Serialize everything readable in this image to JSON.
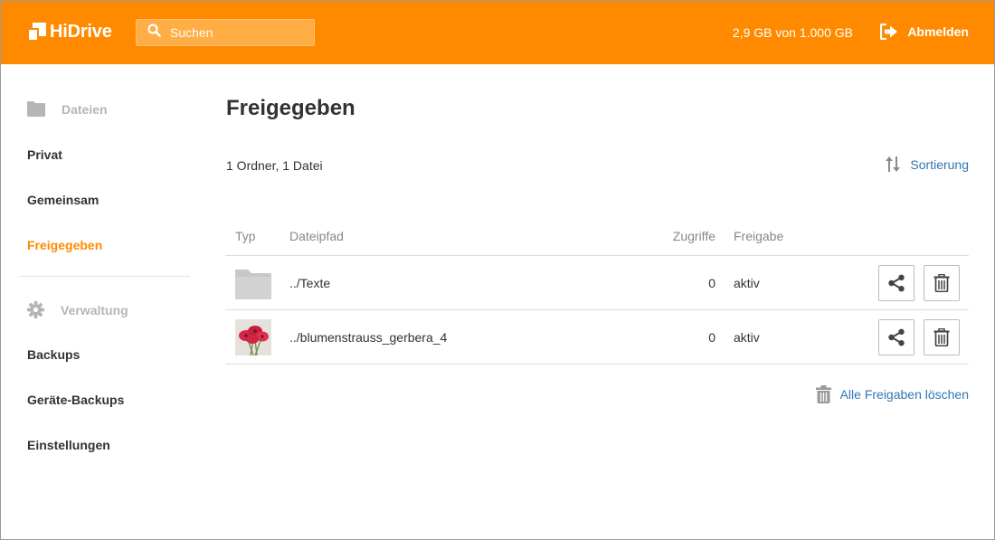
{
  "header": {
    "logo_text": "HiDrive",
    "search_placeholder": "Suchen",
    "quota": "2,9 GB von 1.000 GB",
    "logout_label": "Abmelden",
    "accent_color": "#ff8a00"
  },
  "sidebar": {
    "section_files": "Dateien",
    "items_files": [
      {
        "label": "Privat",
        "active": false
      },
      {
        "label": "Gemeinsam",
        "active": false
      },
      {
        "label": "Freigegeben",
        "active": true
      }
    ],
    "section_admin": "Verwaltung",
    "items_admin": [
      {
        "label": "Backups"
      },
      {
        "label": "Geräte-Backups"
      },
      {
        "label": "Einstellungen"
      }
    ]
  },
  "main": {
    "title": "Freigegeben",
    "summary": "1 Ordner, 1 Datei",
    "sort_label": "Sortierung",
    "columns": {
      "type": "Typ",
      "path": "Dateipfad",
      "access": "Zugriffe",
      "share": "Freigabe"
    },
    "rows": [
      {
        "type_icon": "folder-icon",
        "path": "../Texte",
        "access": "0",
        "share": "aktiv"
      },
      {
        "type_icon": "image-thumbnail",
        "path": "../blumenstrauss_gerbera_4",
        "access": "0",
        "share": "aktiv"
      }
    ],
    "delete_all_label": "Alle Freigaben löschen",
    "link_color": "#2f76b3"
  }
}
